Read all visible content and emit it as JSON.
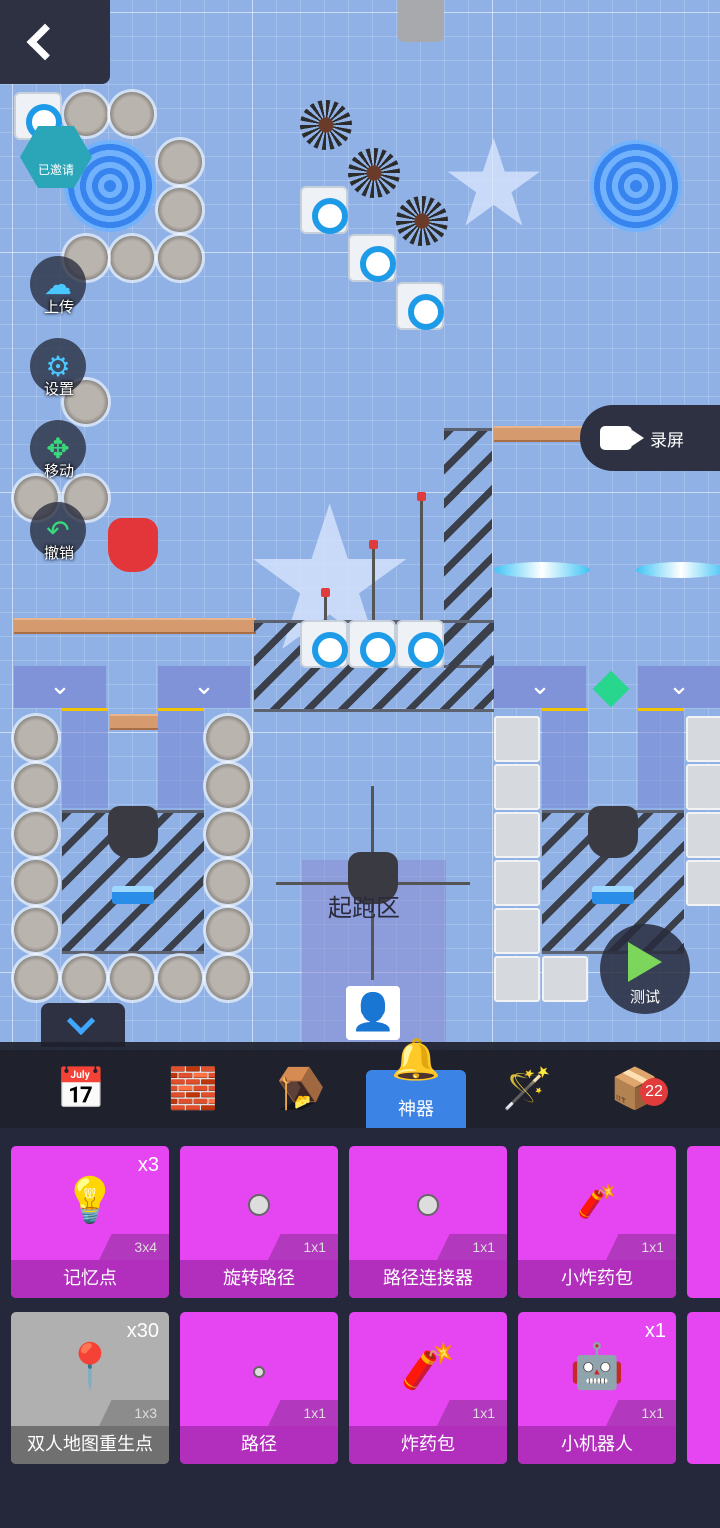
{
  "canvas": {
    "start_zone_label": "起跑区"
  },
  "controls": {
    "invited_label": "已邀请",
    "upload_label": "上传",
    "settings_label": "设置",
    "move_label": "移动",
    "undo_label": "撤销",
    "record_label": "录屏",
    "test_label": "测试"
  },
  "tabs": {
    "active_label": "神器",
    "box_badge": "22"
  },
  "items": [
    {
      "name": "记忆点",
      "count": "x3",
      "size": "3x4"
    },
    {
      "name": "旋转路径",
      "count": "",
      "size": "1x1"
    },
    {
      "name": "路径连接器",
      "count": "",
      "size": "1x1"
    },
    {
      "name": "小炸药包",
      "count": "",
      "size": "1x1"
    },
    {
      "name": "双人地图重生点",
      "count": "x30",
      "size": "1x3"
    },
    {
      "name": "路径",
      "count": "",
      "size": "1x1"
    },
    {
      "name": "炸药包",
      "count": "",
      "size": "1x1"
    },
    {
      "name": "小机器人",
      "count": "x1",
      "size": "1x1"
    }
  ],
  "icons": {
    "back": "back-arrow-icon",
    "upload": "cloud-upload-icon",
    "settings": "gear-icon",
    "move": "move-arrows-icon",
    "undo": "undo-arrow-icon",
    "record": "video-camera-icon",
    "test": "play-icon"
  },
  "colors": {
    "canvas_bg": "#8fb1e6",
    "card_magenta": "#e646f2",
    "active_tab": "#3c83e6",
    "play_green": "#7cd65b"
  }
}
